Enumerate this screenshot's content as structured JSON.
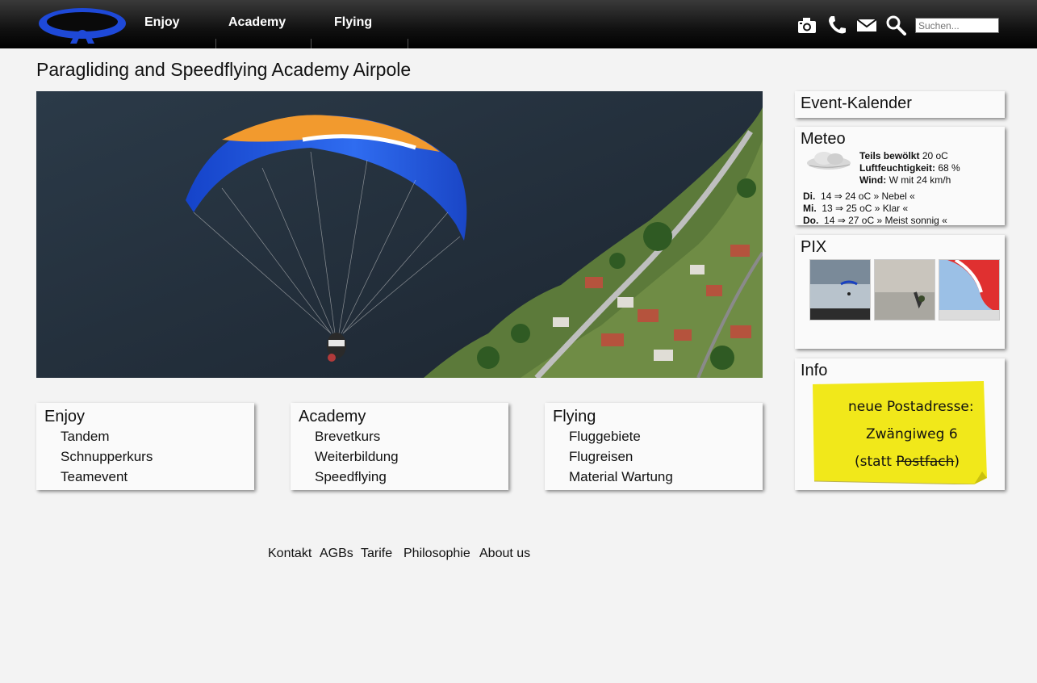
{
  "nav": {
    "items": [
      {
        "label": "Enjoy"
      },
      {
        "label": "Academy"
      },
      {
        "label": "Flying"
      }
    ],
    "search_placeholder": "Suchen...",
    "icons": [
      "camera-icon",
      "phone-icon",
      "mail-icon",
      "search-icon"
    ]
  },
  "page_title": "Paragliding and Speedflying Academy Airpole",
  "categories": [
    {
      "title": "Enjoy",
      "links": [
        "Tandem",
        "Schnupperkurs",
        "Teamevent"
      ]
    },
    {
      "title": "Academy",
      "links": [
        "Brevetkurs",
        "Weiterbildung",
        "Speedflying"
      ]
    },
    {
      "title": "Flying",
      "links": [
        "Fluggebiete",
        "Flugreisen",
        "Material Wartung"
      ]
    }
  ],
  "sidebar": {
    "event_title": "Event-Kalender",
    "meteo": {
      "title": "Meteo",
      "condition": "Teils bewölkt",
      "temperature": "20 oC",
      "humidity_label": "Luftfeuchtigkeit:",
      "humidity_value": "68 %",
      "wind_label": "Wind:",
      "wind_value": "W mit 24 km/h",
      "forecast": [
        {
          "day": "Di.",
          "text": "14 ⇒ 24 oC » Nebel «"
        },
        {
          "day": "Mi.",
          "text": "13 ⇒ 25 oC » Klar «"
        },
        {
          "day": "Do.",
          "text": "14 ⇒ 27 oC » Meist sonnig «"
        }
      ]
    },
    "pix_title": "PIX",
    "info": {
      "title": "Info",
      "line1": "neue Postadresse:",
      "line2": "Zwängiweg 6",
      "line3_prefix": "(statt ",
      "line3_strike": "Postfach",
      "line3_suffix": ")"
    }
  },
  "footer": {
    "links": [
      "Kontakt",
      "AGBs",
      "Tarife",
      "Philosophie",
      "About us"
    ]
  },
  "colors": {
    "logo_blue": "#1e49d8",
    "postit_yellow": "#f1e81a",
    "topbar": "#111111"
  }
}
